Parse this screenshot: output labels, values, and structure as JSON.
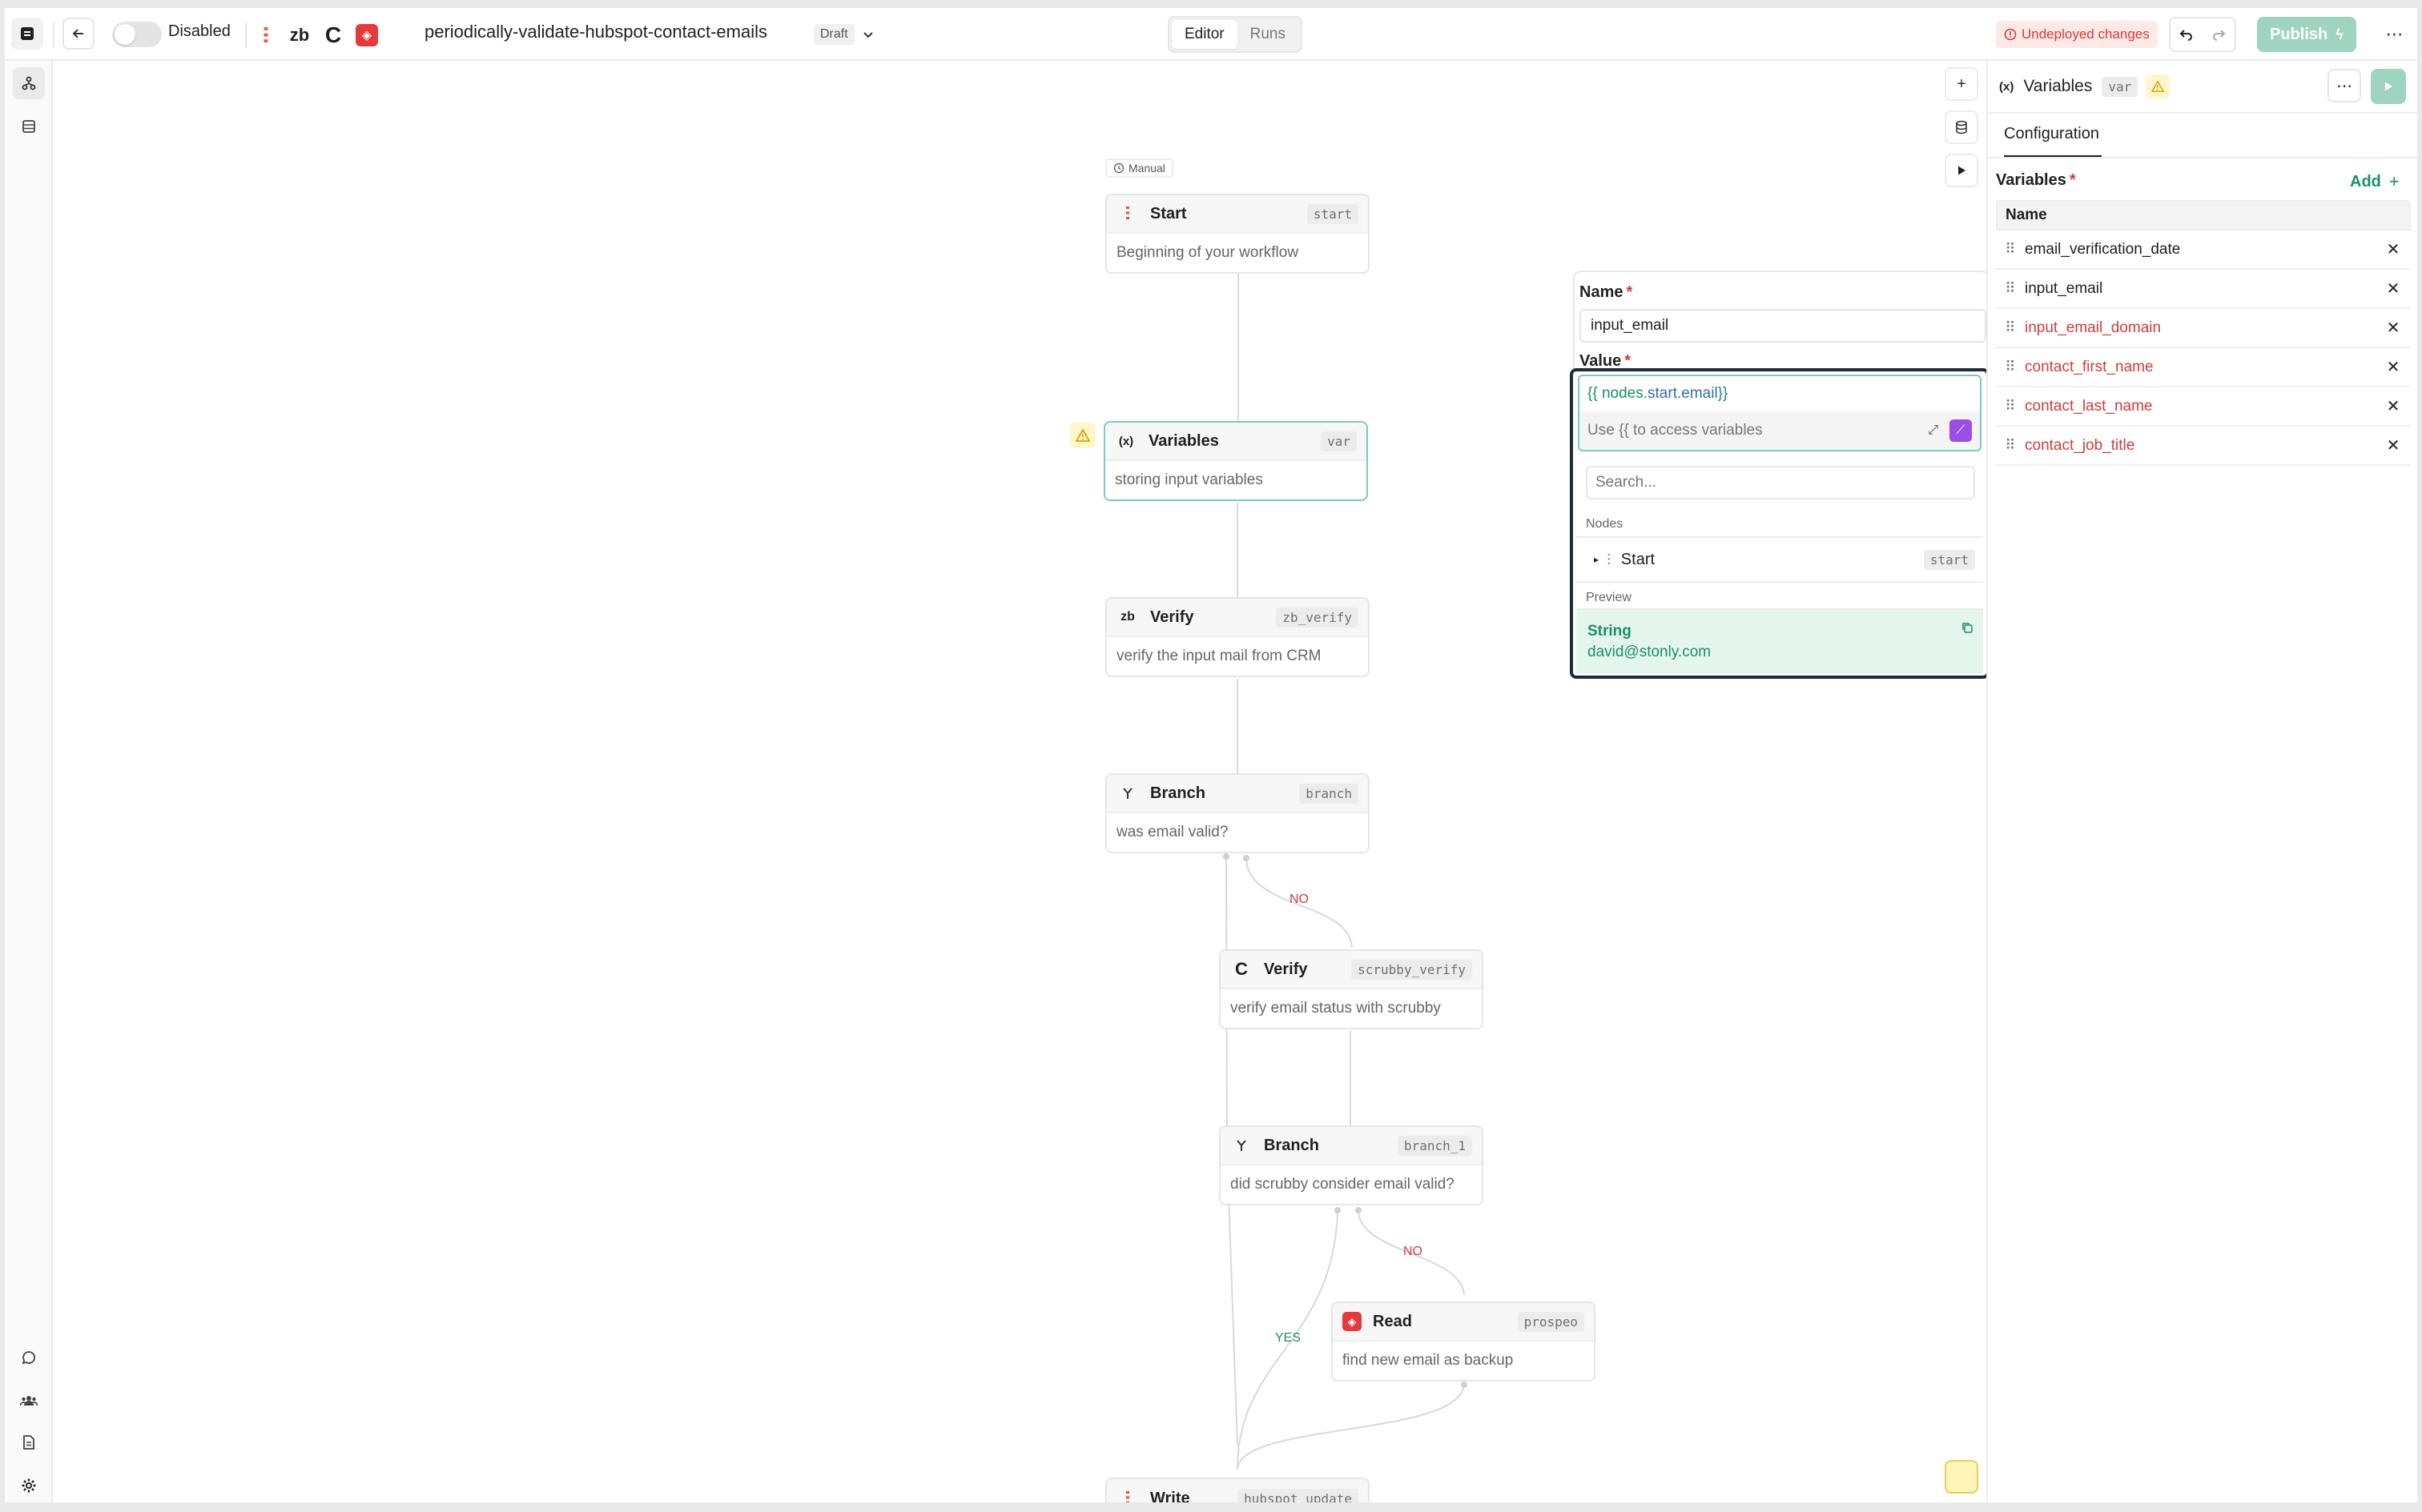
{
  "topbar": {
    "toggle_label": "Disabled",
    "workflow_name": "periodically-validate-hubspot-contact-emails",
    "status_badge": "Draft",
    "tabs": [
      "Editor",
      "Runs"
    ],
    "undeployed_label": "Undeployed changes",
    "publish_label": "Publish",
    "integrations": [
      {
        "name": "hubspot-icon",
        "glyph": "ⵗ"
      },
      {
        "name": "zerobounce-icon",
        "glyph": "zb"
      },
      {
        "name": "scrubby-icon",
        "glyph": "C"
      },
      {
        "name": "prospeo-icon",
        "glyph": "◈"
      }
    ]
  },
  "canvas": {
    "trigger_label": "Manual",
    "nodes": [
      {
        "title": "Start",
        "id": "start",
        "desc": "Beginning of your workflow",
        "icon": "hubspot-icon"
      },
      {
        "title": "Variables",
        "id": "var",
        "desc": "storing input variables",
        "icon": "variables-icon"
      },
      {
        "title": "Verify",
        "id": "zb_verify",
        "desc": "verify the input mail from CRM",
        "icon": "zerobounce-icon"
      },
      {
        "title": "Branch",
        "id": "branch",
        "desc": "was email valid?",
        "icon": "branch-icon"
      },
      {
        "title": "Verify",
        "id": "scrubby_verify",
        "desc": "verify email status with scrubby",
        "icon": "scrubby-icon"
      },
      {
        "title": "Branch",
        "id": "branch_1",
        "desc": "did scrubby consider email valid?",
        "icon": "branch-icon"
      },
      {
        "title": "Read",
        "id": "prospeo",
        "desc": "find new email as backup",
        "icon": "prospeo-icon"
      },
      {
        "title": "Write",
        "id": "hubspot_update",
        "desc": "",
        "icon": "hubspot-icon"
      }
    ],
    "edge_labels": {
      "no_1": "NO",
      "no_2": "NO",
      "yes_1": "YES"
    }
  },
  "popover": {
    "name_label": "Name",
    "name_value": "input_email",
    "value_label": "Value",
    "value_expr_prefix": "{{ nodes.",
    "value_expr_start": "start",
    "value_expr_mid": ".",
    "value_expr_field": "email",
    "value_expr_suffix": " }}",
    "hint": "Use {{ to access variables",
    "search_placeholder": "Search...",
    "nodes_heading": "Nodes",
    "node_item_label": "Start",
    "node_item_id": "start",
    "preview_heading": "Preview",
    "preview_type": "String",
    "preview_value": "david@stonly.com"
  },
  "panel": {
    "title": "Variables",
    "id": "var",
    "tab": "Configuration",
    "section_label": "Variables",
    "add_label": "Add",
    "column_name": "Name",
    "variables": [
      {
        "name": "email_verification_date",
        "error": false
      },
      {
        "name": "input_email",
        "error": false
      },
      {
        "name": "input_email_domain",
        "error": true
      },
      {
        "name": "contact_first_name",
        "error": true
      },
      {
        "name": "contact_last_name",
        "error": true
      },
      {
        "name": "contact_job_title",
        "error": true
      }
    ]
  },
  "colors": {
    "accent_green": "#1a8f6b",
    "error_red": "#d23b3b",
    "publish_bg": "#9fd4c0",
    "selected_border": "#7fc9bd"
  }
}
